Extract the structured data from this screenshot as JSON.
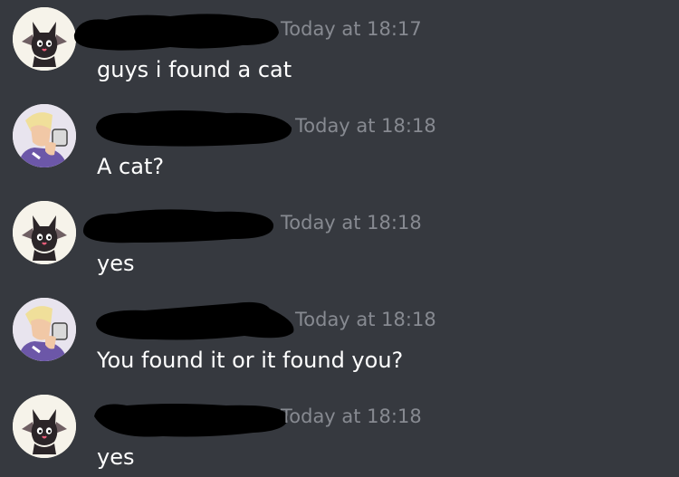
{
  "colors": {
    "background": "#36393f",
    "timestamp": "#878a91",
    "message_text": "#ffffff",
    "redaction": "#000000"
  },
  "messages": [
    {
      "avatar": "bat-cat-avatar",
      "timestamp": "Today at 18:17",
      "text": "guys i found a cat"
    },
    {
      "avatar": "coffee-person-avatar",
      "timestamp": "Today at 18:18",
      "text": "A cat?"
    },
    {
      "avatar": "bat-cat-avatar",
      "timestamp": "Today at 18:18",
      "text": "yes"
    },
    {
      "avatar": "coffee-person-avatar",
      "timestamp": "Today at 18:18",
      "text": "You found it or it found you?"
    },
    {
      "avatar": "bat-cat-avatar",
      "timestamp": "Today at 18:18",
      "text": "yes"
    }
  ]
}
